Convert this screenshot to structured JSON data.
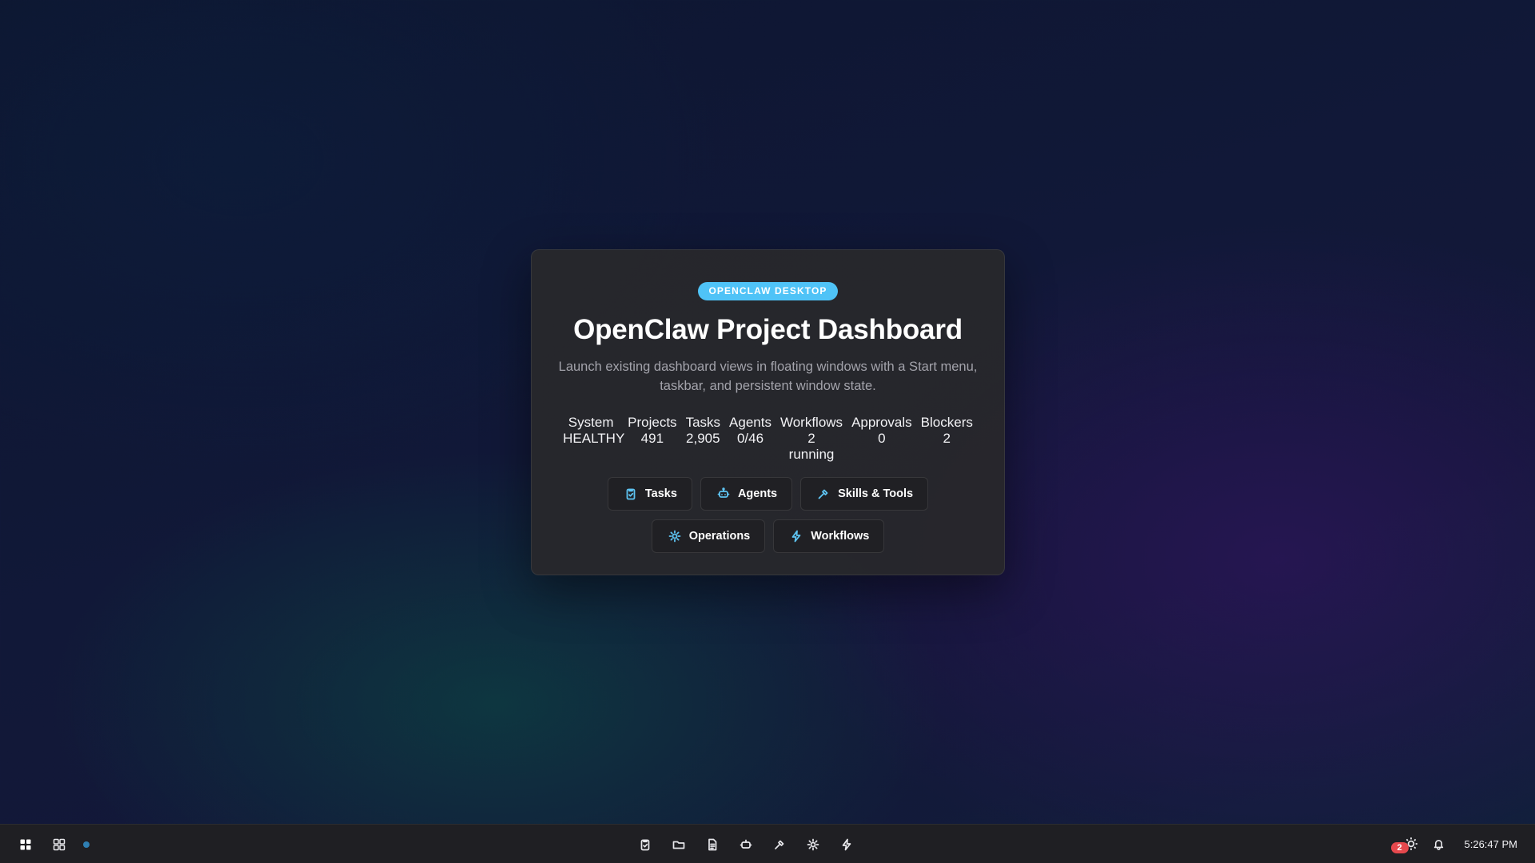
{
  "launcher": {
    "badge": "OPENCLAW DESKTOP",
    "title": "OpenClaw Project Dashboard",
    "subtitle": "Launch existing dashboard views in floating windows with a Start menu, taskbar, and persistent window state.",
    "stats": [
      {
        "label": "System",
        "value": "HEALTHY"
      },
      {
        "label": "Projects",
        "value": "491"
      },
      {
        "label": "Tasks",
        "value": "2,905"
      },
      {
        "label": "Agents",
        "value": "0/46"
      },
      {
        "label": "Workflows",
        "value": "2 running"
      },
      {
        "label": "Approvals",
        "value": "0"
      },
      {
        "label": "Blockers",
        "value": "2"
      }
    ],
    "buttons": {
      "tasks": "Tasks",
      "agents": "Agents",
      "skills_tools": "Skills & Tools",
      "operations": "Operations",
      "workflows": "Workflows"
    },
    "accent_color": "#4fc3f7"
  },
  "taskbar": {
    "left_icons": [
      "start-menu-icon",
      "app-grid-icon",
      "status-dot"
    ],
    "center_icons": [
      "tasks-icon",
      "folder-icon",
      "document-icon",
      "agents-icon",
      "skills-tools-icon",
      "operations-icon",
      "workflows-icon"
    ],
    "tray": {
      "notification_count": "2",
      "clock": "5:26:47 PM"
    }
  }
}
